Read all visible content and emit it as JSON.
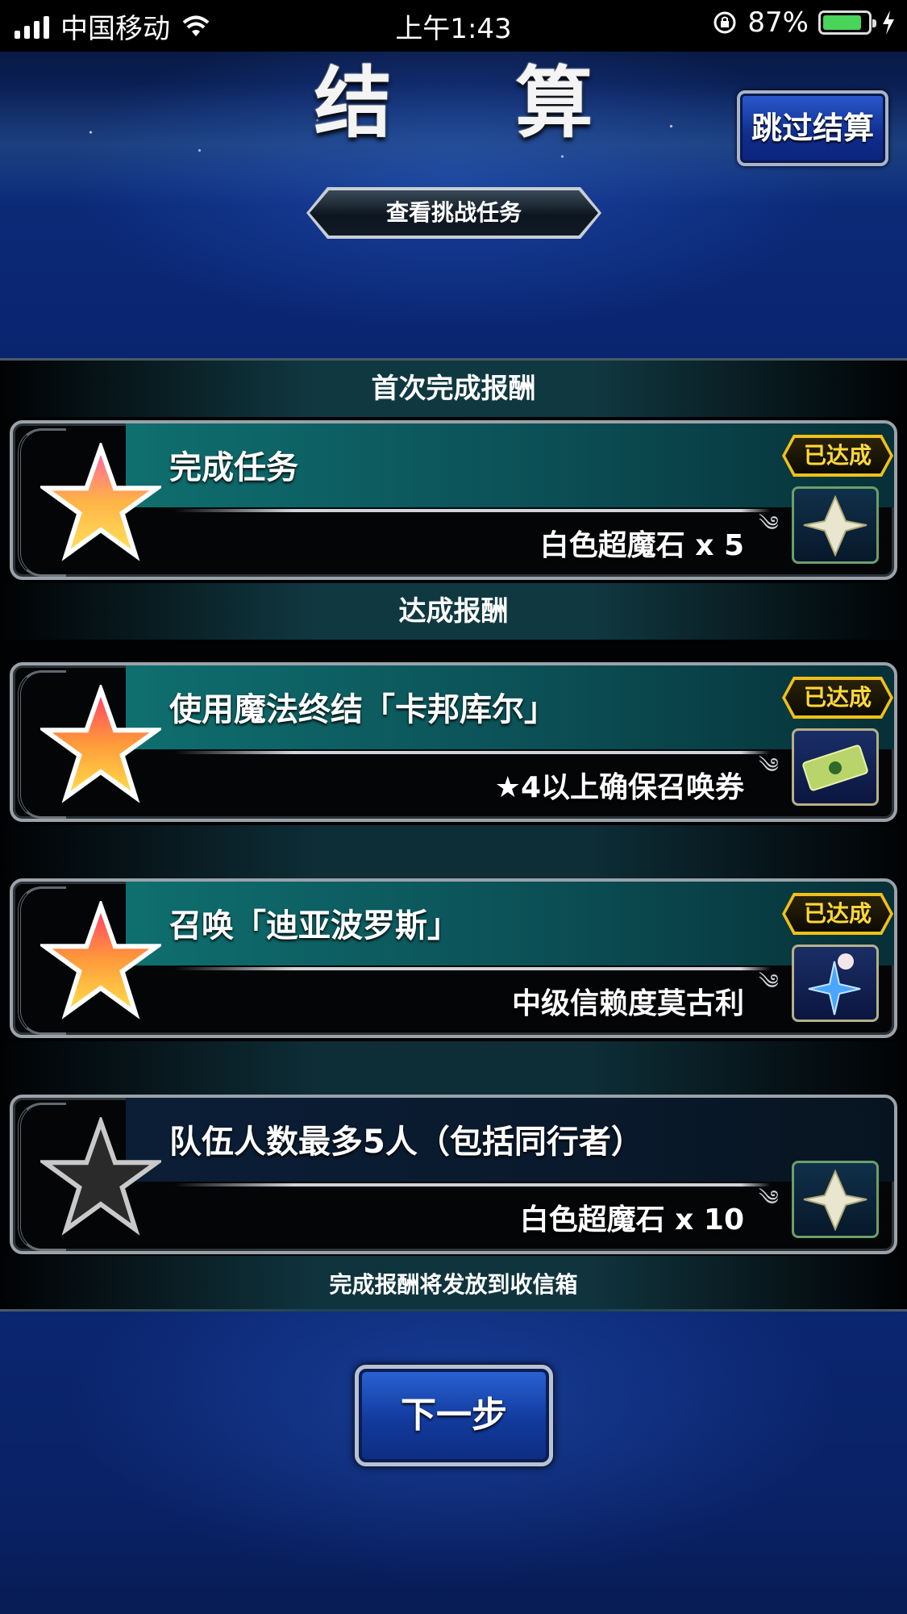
{
  "status_bar": {
    "carrier": "中国移动",
    "time": "上午1:43",
    "battery_percent": "87%",
    "battery_level": 0.87
  },
  "header": {
    "title": "结 算",
    "skip_button": "跳过结算",
    "view_missions_button": "查看挑战任务"
  },
  "sections": {
    "first_clear_title": "首次完成报酬",
    "achievement_title": "达成报酬",
    "footer_note": "完成报酬将发放到收信箱"
  },
  "missions": [
    {
      "text": "完成任务",
      "reward": "白色超魔石 x 5",
      "badge": "已达成",
      "achieved": true
    },
    {
      "text": "使用魔法终结「卡邦库尔」",
      "reward": "★4以上确保召唤券",
      "badge": "已达成",
      "achieved": true
    },
    {
      "text": "召唤「迪亚波罗斯」",
      "reward": "中级信赖度莫古利",
      "badge": "已达成",
      "achieved": true
    },
    {
      "text": "队伍人数最多5人（包括同行者）",
      "reward": "白色超魔石 x 10",
      "badge": "",
      "achieved": false
    }
  ],
  "next_button": "下一步",
  "icons": [
    "wifi-icon",
    "rotation-lock-icon",
    "battery-icon",
    "charging-icon",
    "star-icon",
    "crystal-icon",
    "ticket-icon",
    "moogle-icon"
  ],
  "colors": {
    "accent_gold": "#f0c019",
    "panel_teal": "#0f6f6f",
    "button_blue": "#123a9c"
  }
}
